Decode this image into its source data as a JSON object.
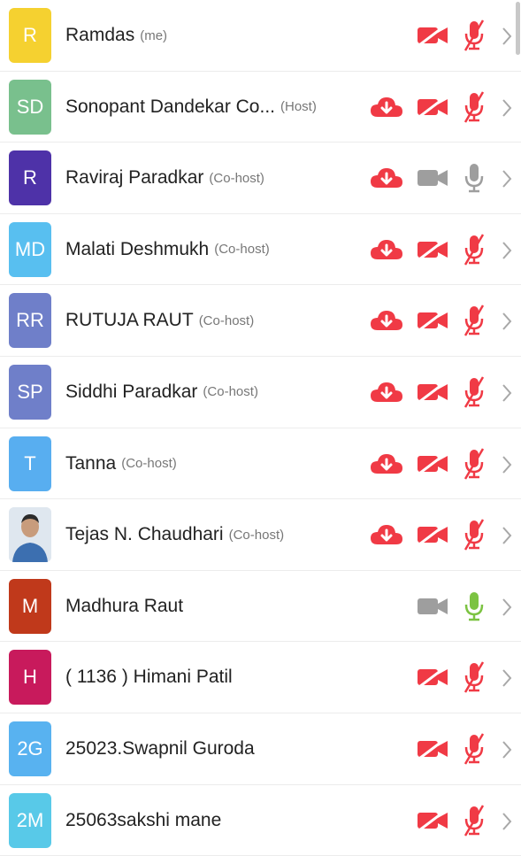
{
  "colors": {
    "muted_red": "#f03a45",
    "gray_icon": "#9e9e9e",
    "unmuted_green": "#7cc342"
  },
  "participants": [
    {
      "initials": "R",
      "name": "Ramdas",
      "role": "(me)",
      "color": "#f5d130",
      "photo": false,
      "cloud": false,
      "video": "off-red",
      "mic": "muted-red"
    },
    {
      "initials": "SD",
      "name": "Sonopant Dandekar Co...",
      "role": "(Host)",
      "color": "#79c08d",
      "photo": false,
      "cloud": true,
      "video": "off-red",
      "mic": "muted-red"
    },
    {
      "initials": "R",
      "name": "Raviraj Paradkar",
      "role": "(Co-host)",
      "color": "#4e32a8",
      "photo": false,
      "cloud": true,
      "video": "on-gray",
      "mic": "idle-gray"
    },
    {
      "initials": "MD",
      "name": "Malati Deshmukh",
      "role": "(Co-host)",
      "color": "#58bff0",
      "photo": false,
      "cloud": true,
      "video": "off-red",
      "mic": "muted-red"
    },
    {
      "initials": "RR",
      "name": "RUTUJA RAUT",
      "role": "(Co-host)",
      "color": "#6f7fc9",
      "photo": false,
      "cloud": true,
      "video": "off-red",
      "mic": "muted-red"
    },
    {
      "initials": "SP",
      "name": "Siddhi Paradkar",
      "role": "(Co-host)",
      "color": "#6f7fc9",
      "photo": false,
      "cloud": true,
      "video": "off-red",
      "mic": "muted-red"
    },
    {
      "initials": "T",
      "name": "Tanna",
      "role": "(Co-host)",
      "color": "#58aef0",
      "photo": false,
      "cloud": true,
      "video": "off-red",
      "mic": "muted-red"
    },
    {
      "initials": "",
      "name": "Tejas N. Chaudhari",
      "role": "(Co-host)",
      "color": "#dfe7ef",
      "photo": true,
      "cloud": true,
      "video": "off-red",
      "mic": "muted-red"
    },
    {
      "initials": "M",
      "name": "Madhura Raut",
      "role": "",
      "color": "#c0391b",
      "photo": false,
      "cloud": false,
      "video": "on-gray",
      "mic": "unmuted-green"
    },
    {
      "initials": "H",
      "name": "( 1136 ) Himani Patil",
      "role": "",
      "color": "#c81a5c",
      "photo": false,
      "cloud": false,
      "video": "off-red",
      "mic": "muted-red"
    },
    {
      "initials": "2G",
      "name": "25023.Swapnil Guroda",
      "role": "",
      "color": "#58b2f0",
      "photo": false,
      "cloud": false,
      "video": "off-red",
      "mic": "muted-red"
    },
    {
      "initials": "2M",
      "name": "25063sakshi mane",
      "role": "",
      "color": "#58c9e8",
      "photo": false,
      "cloud": false,
      "video": "off-red",
      "mic": "muted-red"
    }
  ]
}
